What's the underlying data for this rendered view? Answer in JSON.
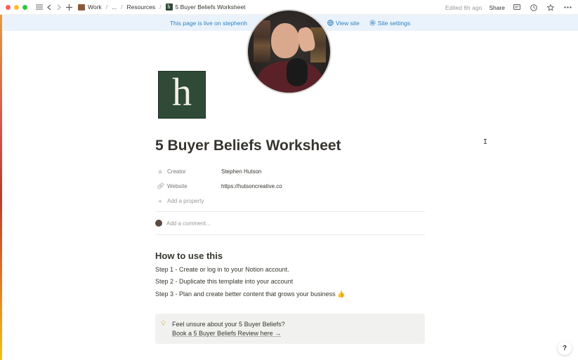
{
  "breadcrumb": {
    "items": [
      "Work",
      "...",
      "Resources",
      "5 Buyer Beliefs Worksheet"
    ]
  },
  "topbar": {
    "edited": "Edited 6h ago",
    "share_label": "Share",
    "icons": [
      "menu-icon",
      "back-icon",
      "forward-icon",
      "plus-icon",
      "comment-icon",
      "clock-icon",
      "star-icon",
      "more-icon"
    ]
  },
  "banner": {
    "text": "This page is live on stephenh",
    "view_site": "View site",
    "site_settings": "Site settings"
  },
  "page": {
    "icon_letter": "h",
    "title": "5 Buyer Beliefs Worksheet",
    "properties": [
      {
        "key": "Creator",
        "value": "Stephen Hutson"
      },
      {
        "key": "Website",
        "value": "https://hutsoncreative.co"
      }
    ],
    "add_property": "Add a property",
    "comment_placeholder": "Add a comment...",
    "heading": "How to use this",
    "steps": [
      "Step 1 - Create or log in to your Notion account.",
      "Step 2 - Duplicate this template into your account",
      "Step 3 - Plan and create better content that grows your business 👍"
    ],
    "callout": {
      "line1": "Feel unsure about your 5 Buyer Beliefs?",
      "link": "Book a 5 Buyer Beliefs Review here →"
    }
  },
  "help_label": "?",
  "colors": {
    "banner_bg": "#eaf3fb",
    "banner_text": "#2f80c4",
    "icon_bg": "#2f4a36",
    "callout_bg": "#f1f1ef"
  }
}
